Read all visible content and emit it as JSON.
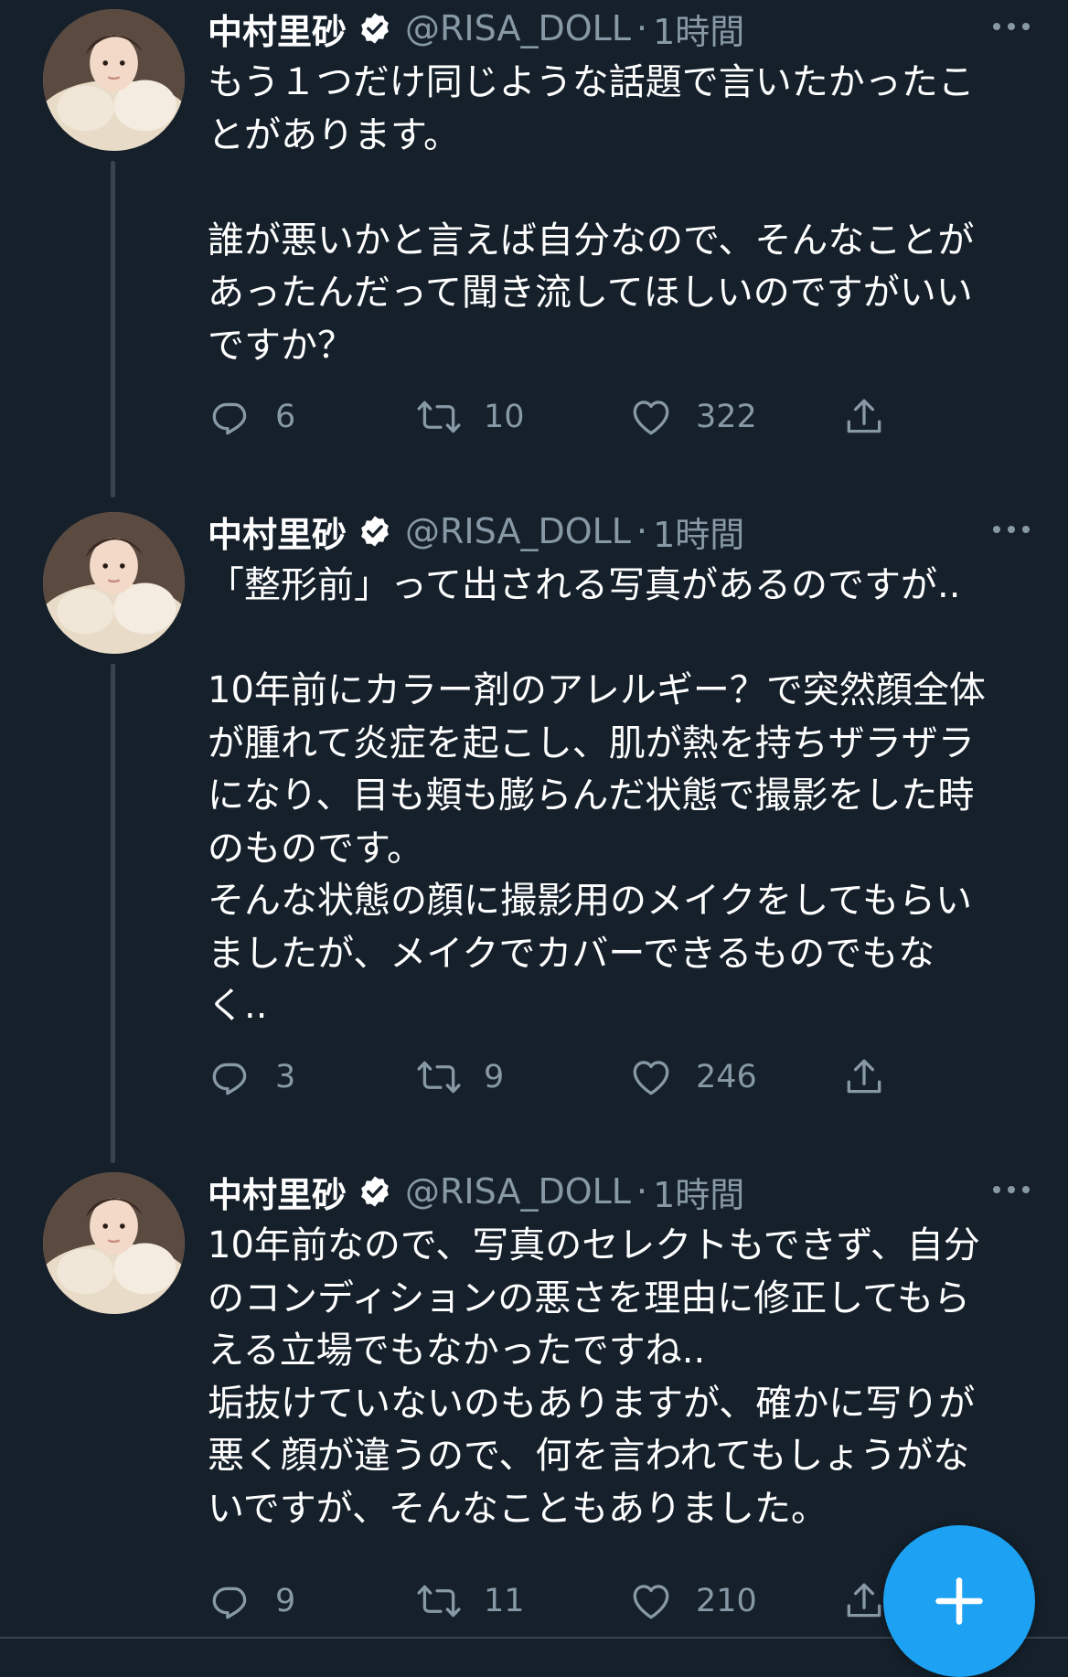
{
  "colors": {
    "background": "#15202b",
    "text_primary": "#ffffff",
    "text_secondary": "#8899a6",
    "accent": "#1da1f2",
    "thread_line": "#38444d"
  },
  "tweets": [
    {
      "author": {
        "name": "中村里砂",
        "handle": "@RISA_DOLL",
        "verified": true,
        "avatar_icon": "profile-photo"
      },
      "separator": "·",
      "time": "1時間",
      "text_lines": [
        "もう１つだけ同じような話題で言いたかったこ",
        "とがあります。",
        "",
        "誰が悪いかと言えば自分なので、そんなことが",
        "あったんだって聞き流してほしいのですがいい",
        "ですか？"
      ],
      "stats": {
        "replies": "6",
        "retweets": "10",
        "likes": "322"
      }
    },
    {
      "author": {
        "name": "中村里砂",
        "handle": "@RISA_DOLL",
        "verified": true,
        "avatar_icon": "profile-photo"
      },
      "separator": "·",
      "time": "1時間",
      "text_lines": [
        "「整形前」って出される写真があるのですが..",
        "",
        "10年前にカラー剤のアレルギー？で突然顔全体",
        "が腫れて炎症を起こし、肌が熱を持ちザラザラ",
        "になり、目も頬も膨らんだ状態で撮影をした時",
        "のものです。",
        "そんな状態の顔に撮影用のメイクをしてもらい",
        "ましたが、メイクでカバーできるものでもな",
        "く.."
      ],
      "stats": {
        "replies": "3",
        "retweets": "9",
        "likes": "246"
      }
    },
    {
      "author": {
        "name": "中村里砂",
        "handle": "@RISA_DOLL",
        "verified": true,
        "avatar_icon": "profile-photo"
      },
      "separator": "·",
      "time": "1時間",
      "text_lines": [
        "10年前なので、写真のセレクトもできず、自分",
        "のコンディションの悪さを理由に修正してもら",
        "える立場でもなかったですね..",
        "垢抜けていないのもありますが、確かに写りが",
        "悪く顔が違うので、何を言われてもしょうがな",
        "いですが、そんなこともありました。"
      ],
      "stats": {
        "replies": "9",
        "retweets": "11",
        "likes": "210"
      }
    }
  ],
  "fab": {
    "icon": "plus-icon"
  }
}
